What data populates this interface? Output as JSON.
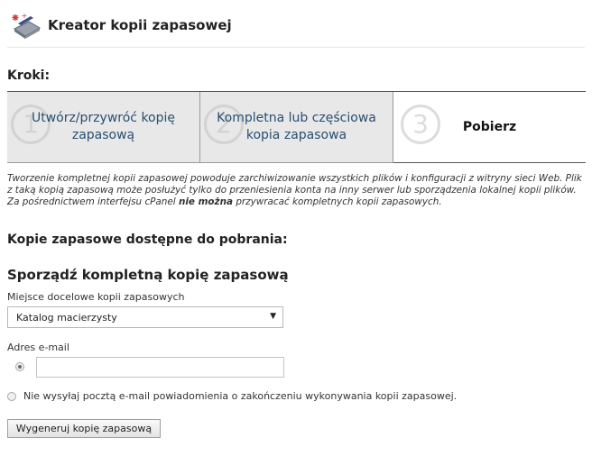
{
  "header": {
    "title": "Kreator kopii zapasowej",
    "icon": "backup-wizard-icon"
  },
  "steps": {
    "heading": "Kroki:",
    "items": [
      {
        "number": "1",
        "label": "Utwórz/przywróć kopię zapasową",
        "state": "inactive"
      },
      {
        "number": "2",
        "label": "Kompletna lub częściowa kopia zapasowa",
        "state": "inactive"
      },
      {
        "number": "3",
        "label": "Pobierz",
        "state": "active"
      }
    ]
  },
  "info": {
    "text_before": "Tworzenie kompletnej kopii zapasowej powoduje zarchiwizowanie wszystkich plików i konfiguracji z witryny sieci Web. Plik z taką kopią zapasową może posłużyć tylko do przeniesienia konta na inny serwer lub sporządzenia lokalnej kopii plików. Za pośrednictwem interfejsu cPanel ",
    "emphasis": "nie można",
    "text_after": " przywracać kompletnych kopii zapasowych."
  },
  "available_heading": "Kopie zapasowe dostępne do pobrania:",
  "full_backup": {
    "heading": "Sporządź kompletną kopię zapasową",
    "destination_label": "Miejsce docelowe kopii zapasowych",
    "destination_value": "Katalog macierzysty",
    "email_label": "Adres e-mail",
    "email_value": "",
    "email_radio_checked": true,
    "no_email_label": "Nie wysyłaj pocztą e-mail powiadomienia o zakończeniu wykonywania kopii zapasowej.",
    "no_email_radio_checked": false,
    "submit_label": "Wygeneruj kopię zapasową"
  },
  "colors": {
    "step_inactive_bg": "#e8e8e8",
    "step_label": "#2a4e72",
    "step_number": "#d2d2d2"
  }
}
